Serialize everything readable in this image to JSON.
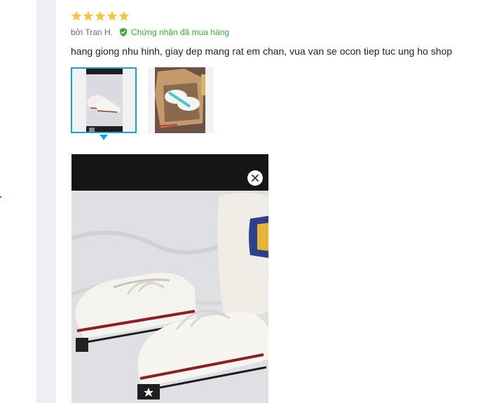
{
  "review": {
    "rating": 5,
    "rating_max": 5,
    "author": "bởi Tran H.",
    "verified_label": "Chứng nhận đã mua hàng",
    "comment": "hang giong nhu hinh, giay dep mang rat em chan, vua van se ocon tiep tuc ung ho shop",
    "thumbnails": [
      {
        "icon": "shoe-photo-thumbnail",
        "selected": true
      },
      {
        "icon": "shoebox-photo-thumbnail",
        "selected": false
      }
    ]
  },
  "viewer": {
    "close_icon": "close-icon"
  },
  "colors": {
    "star": "#f9c53f",
    "verified": "#3aaa35",
    "selected_border": "#1a9fd0",
    "text": "#222222",
    "meta_text": "#6b6b6b"
  }
}
